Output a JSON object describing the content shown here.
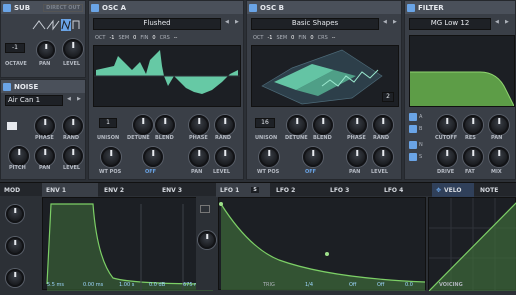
{
  "sub": {
    "title": "SUB",
    "direct_out": "DIRECT OUT",
    "octave_value": "-1",
    "octave_label": "OCTAVE",
    "pan_label": "PAN",
    "level_label": "LEVEL"
  },
  "noise": {
    "title": "NOISE",
    "preset": "Air Can 1",
    "phase_label": "PHASE",
    "rand_label": "RAND",
    "pitch_label": "PITCH",
    "pan_label": "PAN",
    "level_label": "LEVEL"
  },
  "osc_a": {
    "title": "OSC A",
    "wavetable": "Flushed",
    "oct_label": "OCT",
    "oct_value": "-1",
    "sem_label": "SEM",
    "sem_value": "0",
    "fin_label": "FIN",
    "fin_value": "0",
    "crs_label": "CRS",
    "crs_value": "--",
    "unison_label": "UNISON",
    "unison_value": "1",
    "detune_label": "DETUNE",
    "blend_label": "BLEND",
    "phase_label": "PHASE",
    "rand_label": "RAND",
    "wtpos_label": "WT POS",
    "off_label": "OFF",
    "pan_label": "PAN",
    "level_label": "LEVEL"
  },
  "osc_b": {
    "title": "OSC B",
    "wavetable": "Basic Shapes",
    "oct_label": "OCT",
    "oct_value": "-1",
    "sem_label": "SEM",
    "sem_value": "0",
    "fin_label": "FIN",
    "fin_value": "0",
    "crs_label": "CRS",
    "crs_value": "--",
    "frame_value": "2",
    "unison_label": "UNISON",
    "unison_value": "16",
    "detune_label": "DETUNE",
    "blend_label": "BLEND",
    "phase_label": "PHASE",
    "rand_label": "RAND",
    "wtpos_label": "WT POS",
    "off_label": "OFF",
    "pan_label": "PAN",
    "level_label": "LEVEL"
  },
  "filter": {
    "title": "FILTER",
    "type": "MG Low 12",
    "route_a": "A",
    "route_b": "B",
    "route_n": "N",
    "route_s": "S",
    "cutoff_label": "CUTOFF",
    "res_label": "RES",
    "pan_label": "PAN",
    "drive_label": "DRIVE",
    "fat_label": "FAT",
    "mix_label": "MIX"
  },
  "mod_tabs": {
    "mod": "MOD",
    "env1": "ENV 1",
    "env2": "ENV 2",
    "env3": "ENV 3",
    "lfo1": "LFO 1",
    "lfo1_badge": "S",
    "lfo2": "LFO 2",
    "lfo3": "LFO 3",
    "lfo4": "LFO 4",
    "velo": "VELO",
    "note": "NOTE"
  },
  "footer": {
    "attack": "5.5 ms",
    "hold": "0.00 ms",
    "decay": "1.00 s",
    "sustain": "0.0 dB",
    "release": "675 ms",
    "trig": "TRIG",
    "lfo_val1": "1/4",
    "lfo_off1": "Off",
    "lfo_off2": "Off",
    "lfo_smooth": "0.0",
    "voicing": "VOICING"
  },
  "colors": {
    "accent": "#6aa4e6",
    "wave": "#6fdcb4",
    "filter_fill": "#5d9d47",
    "env_fill": "#3d6a3a"
  }
}
